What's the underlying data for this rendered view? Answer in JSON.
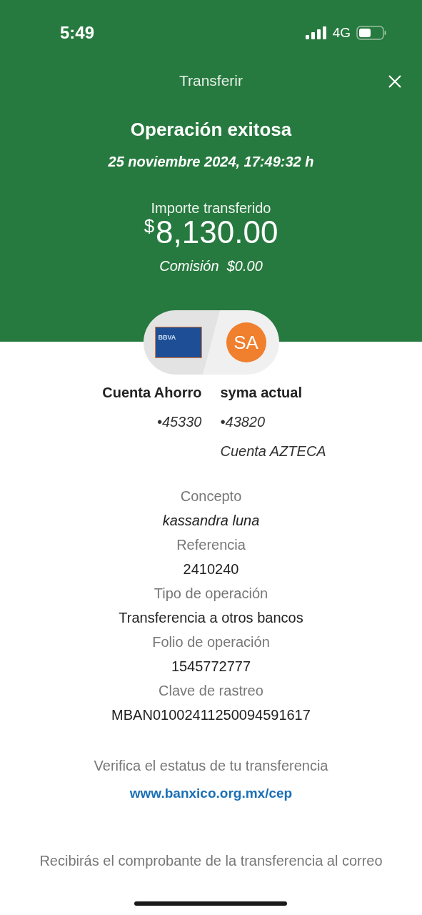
{
  "status_bar": {
    "time": "5:49",
    "network": "4G"
  },
  "header": {
    "title": "Transferir"
  },
  "result": {
    "title": "Operación exitosa",
    "date": "25 noviembre 2024, 17:49:32 h",
    "amount_label": "Importe transferido",
    "currency": "$",
    "amount": "8,130.00",
    "commission": "Comisión  $0.00"
  },
  "origin": {
    "card_label": "BBVA",
    "name": "Cuenta Ahorro",
    "account": "•45330"
  },
  "destination": {
    "initials": "SA",
    "name": "syma actual",
    "account": "•43820",
    "bank": "Cuenta AZTECA"
  },
  "details": [
    {
      "label": "Concepto",
      "value": "kassandra luna",
      "italic": true
    },
    {
      "label": "Referencia",
      "value": "2410240",
      "italic": false
    },
    {
      "label": "Tipo de operación",
      "value": "Transferencia a otros bancos",
      "italic": false
    },
    {
      "label": "Folio de operación",
      "value": "1545772777",
      "italic": false
    },
    {
      "label": "Clave de rastreo",
      "value": "MBAN01002411250094591617",
      "italic": false
    }
  ],
  "verify": {
    "text": "Verifica el estatus de tu transferencia",
    "link": "www.banxico.org.mx/cep"
  },
  "footer_note": "Recibirás el comprobante de la transferencia al correo"
}
